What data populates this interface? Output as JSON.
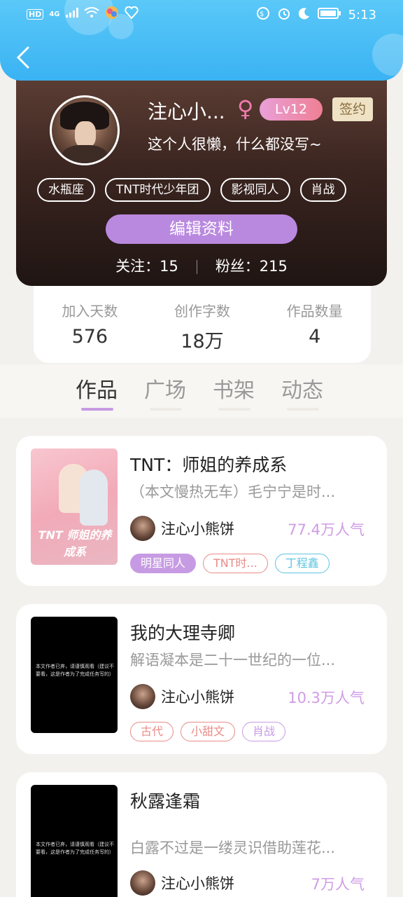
{
  "status_bar": {
    "left_indicators": [
      "HD",
      "4G"
    ],
    "time": "5:13"
  },
  "profile": {
    "name": "注心小...",
    "gender_symbol": "♀",
    "level": "Lv12",
    "signed_badge": "签约",
    "bio": "这个人很懒，什么都没写~",
    "tags": [
      "水瓶座",
      "TNT时代少年团",
      "影视同人",
      "肖战"
    ],
    "edit_button": "编辑资料",
    "following": "关注：15",
    "followers": "粉丝：215"
  },
  "stats": [
    {
      "label": "加入天数",
      "value": "576"
    },
    {
      "label": "创作字数",
      "value": "18万"
    },
    {
      "label": "作品数量",
      "value": "4"
    }
  ],
  "tabs": [
    {
      "label": "作品",
      "active": true
    },
    {
      "label": "广场",
      "active": false
    },
    {
      "label": "书架",
      "active": false
    },
    {
      "label": "动态",
      "active": false
    }
  ],
  "works": [
    {
      "title": "TNT：师姐的养成系",
      "desc": "（本文慢热无车）毛宁宁是时...",
      "author": "注心小熊饼",
      "popularity": "77.4万人气",
      "cover_text": "TNT 师姐的养成系",
      "cover_style": "pink",
      "tags": [
        {
          "label": "明星同人",
          "style": "filled",
          "color": "#c79be3"
        },
        {
          "label": "TNT时...",
          "style": "outline",
          "color": "#e88b86"
        },
        {
          "label": "丁程鑫",
          "style": "outline",
          "color": "#5cc5e0"
        }
      ]
    },
    {
      "title": "我的大理寺卿",
      "desc": "解语凝本是二十一世纪的一位...",
      "author": "注心小熊饼",
      "popularity": "10.3万人气",
      "cover_text": "本文作者已弃，请谨慎观看（建议不要看，这是作者为了完成任务写的）",
      "cover_style": "black",
      "tags": [
        {
          "label": "古代",
          "style": "outline",
          "color": "#e88b86"
        },
        {
          "label": "小甜文",
          "style": "outline",
          "color": "#e88b86"
        },
        {
          "label": "肖战",
          "style": "outline",
          "color": "#c79be3"
        }
      ]
    },
    {
      "title": "秋露逢霜",
      "desc": "白露不过是一缕灵识借助莲花...",
      "author": "注心小熊饼",
      "popularity": "7万人气",
      "cover_text": "本文作者已弃，请谨慎观看（建议不要看，这是作者为了完成任务写的）",
      "cover_style": "black",
      "tags": []
    }
  ],
  "colors": {
    "header": "#3ab3f3",
    "accent_purple": "#b989df",
    "popularity": "#cf9ce4"
  }
}
